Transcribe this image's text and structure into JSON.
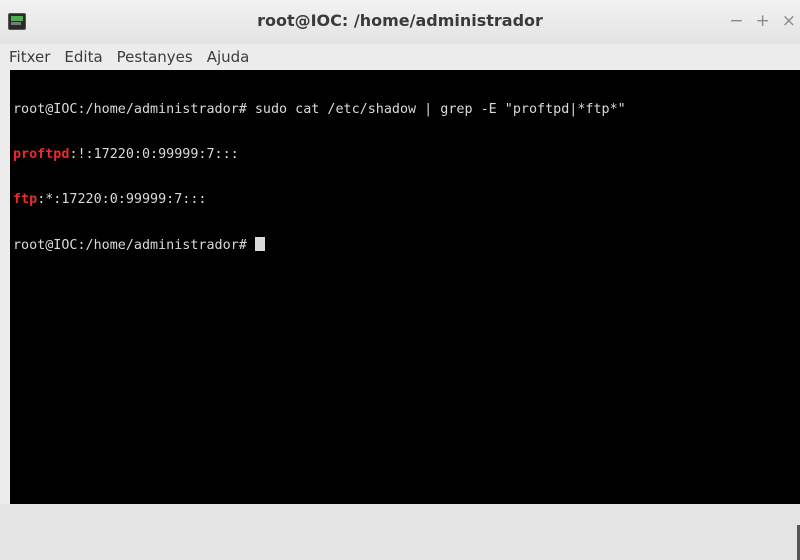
{
  "window": {
    "title": "root@IOC: /home/administrador",
    "controls": {
      "minimize": "−",
      "maximize": "+",
      "close": "×"
    }
  },
  "menu": [
    "Fitxer",
    "Edita",
    "Pestanyes",
    "Ajuda"
  ],
  "terminal": {
    "line1": "root@IOC:/home/administrador# sudo cat /etc/shadow | grep -E \"proftpd|*ftp*\"",
    "line2_match": "proftpd",
    "line2_rest": ":!:17220:0:99999:7:::",
    "line3_match": "ftp",
    "line3_rest": ":*:17220:0:99999:7:::",
    "prompt": "root@IOC:/home/administrador# "
  },
  "colors": {
    "terminal_bg": "#000000",
    "terminal_fg": "#d9d9d9",
    "grep_match": "#ef2929"
  }
}
